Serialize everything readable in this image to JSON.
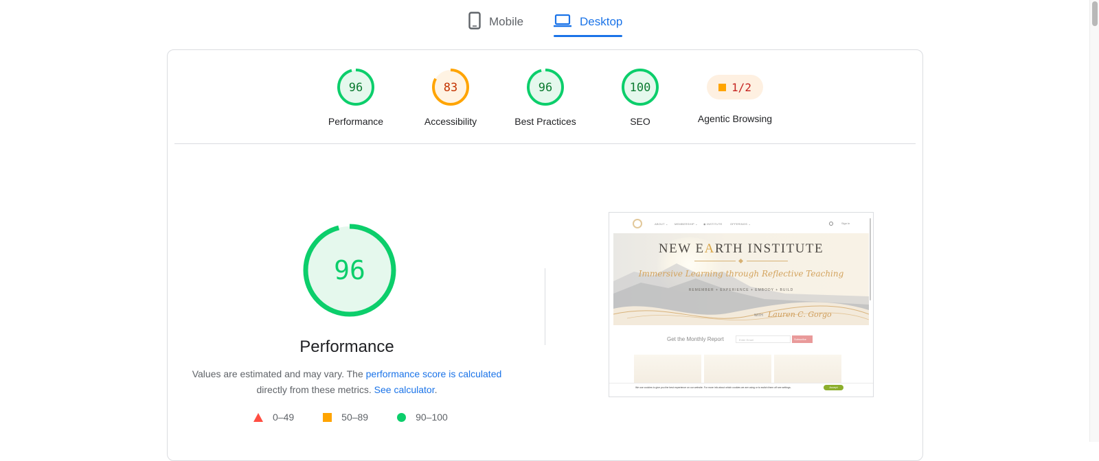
{
  "device_tabs": {
    "mobile": "Mobile",
    "desktop": "Desktop",
    "selected": "Desktop"
  },
  "colors": {
    "pass": "#0cce6b",
    "average": "#ffa400",
    "fail": "#ff4e42",
    "link": "#1a73e8"
  },
  "categories": [
    {
      "score": "96",
      "label": "Performance",
      "rating": "pass"
    },
    {
      "score": "83",
      "label": "Accessibility",
      "rating": "average"
    },
    {
      "score": "96",
      "label": "Best Practices",
      "rating": "pass"
    },
    {
      "score": "100",
      "label": "SEO",
      "rating": "pass"
    }
  ],
  "agentic": {
    "value": "1/2",
    "label": "Agentic Browsing"
  },
  "performance": {
    "score": "96",
    "title": "Performance",
    "desc_prefix": "Values are estimated and may vary. The",
    "desc_link1": "performance score is calculated",
    "desc_middle": "directly from these metrics.",
    "desc_link2": "See calculator",
    "desc_suffix": "."
  },
  "legend": {
    "fail": "0–49",
    "average": "50–89",
    "pass": "90–100"
  },
  "screenshot": {
    "nav_items": [
      "ABOUT ⌄",
      "MEMBERSHIP ⌄",
      "◉ INSTITUTE",
      "OFFERINGS ⌄"
    ],
    "signin": "Sign in",
    "title_pre": "NEW E",
    "title_gold": "A",
    "title_post": "RTH INSTITUTE",
    "script": "Immersive Learning through Reflective Teaching",
    "sub": "REMEMBER + EXPERIENCE + EMBODY + BUILD",
    "with": "WITH",
    "signature": "Lauren C. Gorgo",
    "report": "Get the Monthly Report",
    "email_placeholder": "Enter Email",
    "subscribe": "Subscribe",
    "cookie_text": "We use cookies to give you the best experience on our website. For more info about which cookies we are using or to switch them off see settings.",
    "cookie_btn": "Accept"
  }
}
